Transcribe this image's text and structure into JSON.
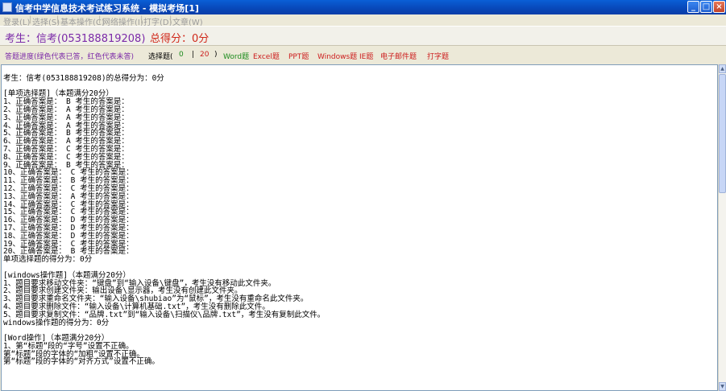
{
  "window": {
    "title": "信考中学信息技术考试练习系统 - 模拟考场[1]",
    "controls": [
      "_",
      "□",
      "×"
    ]
  },
  "menu": [
    "登录(L)",
    "选择(S)",
    "基本操作(C)",
    "网络操作(I)",
    "打字(D)",
    "文章(W)"
  ],
  "header": {
    "student": "考生：信考(053188819208)",
    "score": "总得分：0分"
  },
  "question_bar": {
    "progress": "答题进度(绿色代表已答，红色代表未答)",
    "choice_label": "选择题(",
    "choice_done": "0",
    "choice_sep": "|",
    "choice_total": "20",
    "choice_close": ")",
    "items": [
      "Word题",
      "Excel题",
      "PPT题",
      "Windows题",
      "IE题",
      "电子邮件题",
      "打字题"
    ],
    "colors": {
      "purple": "#7b2aa8",
      "green": "#1a8a1a",
      "red": "#cc1c1c",
      "black": "#000000"
    }
  },
  "report": {
    "lines": [
      "",
      "考生：信考(053188819208)的总得分为：0分",
      "",
      "[单项选择题]（本题满分20分）",
      "1、正确答案是： B 考生的答案是：",
      "2、正确答案是： A 考生的答案是：",
      "3、正确答案是： A 考生的答案是：",
      "4、正确答案是： A 考生的答案是：",
      "5、正确答案是： B 考生的答案是：",
      "6、正确答案是： A 考生的答案是：",
      "7、正确答案是： C 考生的答案是：",
      "8、正确答案是： C 考生的答案是：",
      "9、正确答案是： B 考生的答案是：",
      "10、正确答案是： C 考生的答案是：",
      "11、正确答案是： B 考生的答案是：",
      "12、正确答案是： C 考生的答案是：",
      "13、正确答案是： A 考生的答案是：",
      "14、正确答案是： C 考生的答案是：",
      "15、正确答案是： C 考生的答案是：",
      "16、正确答案是： D 考生的答案是：",
      "17、正确答案是： D 考生的答案是：",
      "18、正确答案是： D 考生的答案是：",
      "19、正确答案是： C 考生的答案是：",
      "20、正确答案是： B 考生的答案是：",
      "单项选择题的得分为：0分",
      "",
      "[windows操作题]（本题满分20分）",
      "1、题目要求移动文件夹：“键盘”到“输入设备\\键盘”，考生没有移动此文件夹。",
      "2、题目要求创建文件夹：输出设备\\显示器，考生没有创建此文件夹。",
      "3、题目要求重命名文件夹：“输入设备\\shubiao”为“鼠标”，考生没有重命名此文件夹。",
      "4、题目要求删除文件：“输入设备\\计算机基础.txt”，考生没有删除此文件。",
      "5、题目要求复制文件：“品牌.txt”到“输入设备\\扫描仪\\品牌.txt”，考生没有复制此文件。",
      "windows操作题的得分为：0分",
      "",
      "[Word操作]（本题满分20分）",
      "1、第“标题”段的“字号”设置不正确。",
      "第“标题”段的字体的“加粗”设置不正确。",
      "第“标题”段的字体的“对齐方式”设置不正确。"
    ]
  }
}
